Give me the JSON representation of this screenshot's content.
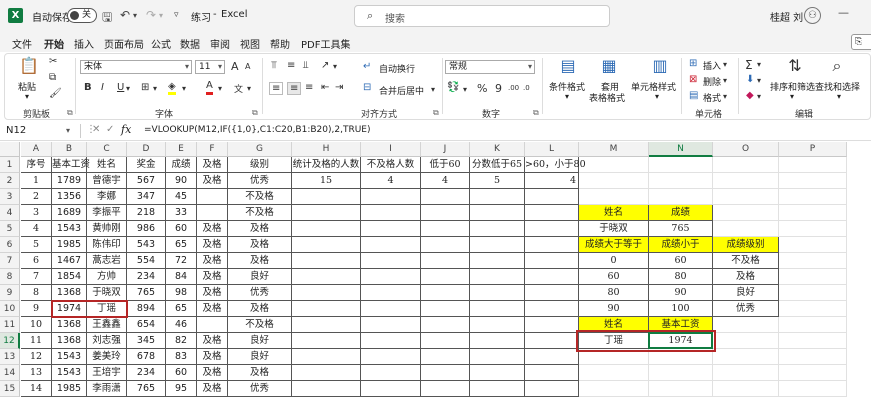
{
  "titlebar": {
    "autosave_label": "自动保存",
    "toggle_state": "关",
    "doc_name": "练习",
    "separator": "-",
    "app_name": "Excel",
    "search_placeholder": "搜索",
    "user_name": "桂超 刘"
  },
  "menu": [
    "文件",
    "开始",
    "插入",
    "页面布局",
    "公式",
    "数据",
    "审阅",
    "视图",
    "帮助",
    "PDF工具集"
  ],
  "ribbon": {
    "clipboard": {
      "label": "剪贴板",
      "paste": "粘贴"
    },
    "font": {
      "label": "字体",
      "font_name": "宋体",
      "font_size": "11",
      "bold": "B",
      "italic": "I",
      "underline": "U",
      "grow": "A",
      "shrink": "A",
      "font_color": "A"
    },
    "alignment": {
      "label": "对齐方式",
      "wrap": "自动换行",
      "merge": "合并后居中"
    },
    "number": {
      "label": "数字",
      "format": "常规",
      "percent": "%",
      "comma": "9",
      "increase": ".00",
      "decrease": ".0"
    },
    "styles": {
      "conditional": "条件格式",
      "table_l1": "套用",
      "table_l2": "表格格式",
      "cell": "单元格样式"
    },
    "cells": {
      "label": "单元格",
      "insert": "插入",
      "delete": "删除",
      "format": "格式"
    },
    "editing": {
      "label": "编辑",
      "sort": "排序和筛选",
      "find": "查找和选择"
    }
  },
  "formula_bar": {
    "name_box": "N12",
    "formula": "=VLOOKUP(M12,IF({1,0},C1:C20,B1:B20),2,TRUE)"
  },
  "colors": {
    "excel_green": "#107c41",
    "highlight_yellow": "#ffff00",
    "annotation_red": "#b52626"
  },
  "sheet": {
    "columns": [
      "A",
      "B",
      "C",
      "D",
      "E",
      "F",
      "G",
      "H",
      "I",
      "J",
      "K",
      "L",
      "M",
      "N",
      "O",
      "P"
    ],
    "rows": [
      "1",
      "2",
      "3",
      "4",
      "5",
      "6",
      "7",
      "8",
      "9",
      "10",
      "11",
      "12",
      "13",
      "14",
      "15"
    ],
    "header_row": [
      "序号",
      "基本工资",
      "姓名",
      "奖金",
      "成绩",
      "及格",
      "级别",
      "统计及格的人数",
      "不及格人数",
      "低于60",
      "分数低于65",
      ">60，小于80"
    ],
    "data": [
      [
        "1",
        "1789",
        "曾德宇",
        "567",
        "90",
        "及格",
        "优秀"
      ],
      [
        "2",
        "1356",
        "李娜",
        "347",
        "45",
        "",
        "不及格"
      ],
      [
        "3",
        "1689",
        "李振平",
        "218",
        "33",
        "",
        "不及格"
      ],
      [
        "4",
        "1543",
        "黄帅刚",
        "986",
        "60",
        "及格",
        "及格"
      ],
      [
        "5",
        "1985",
        "陈伟印",
        "543",
        "65",
        "及格",
        "及格"
      ],
      [
        "6",
        "1467",
        "蒿志岩",
        "554",
        "72",
        "及格",
        "及格"
      ],
      [
        "7",
        "1854",
        "方帅",
        "234",
        "84",
        "及格",
        "良好"
      ],
      [
        "8",
        "1368",
        "于晓双",
        "765",
        "98",
        "及格",
        "优秀"
      ],
      [
        "9",
        "1974",
        "丁瑶",
        "894",
        "65",
        "及格",
        "及格"
      ],
      [
        "10",
        "1368",
        "王鑫鑫",
        "654",
        "46",
        "",
        "不及格"
      ],
      [
        "11",
        "1368",
        "刘志强",
        "345",
        "82",
        "及格",
        "良好"
      ],
      [
        "12",
        "1543",
        "姜美玲",
        "678",
        "83",
        "及格",
        "良好"
      ],
      [
        "13",
        "1543",
        "王培宇",
        "234",
        "60",
        "及格",
        "及格"
      ],
      [
        "14",
        "1985",
        "李雨潇",
        "765",
        "95",
        "及格",
        "优秀"
      ]
    ],
    "stats": [
      "15",
      "4",
      "4",
      "5",
      "4"
    ],
    "lookup1": {
      "h1": "姓名",
      "h2": "成绩",
      "name": "于晓双",
      "score": "765"
    },
    "grade_table": {
      "headers": [
        "成绩大于等于",
        "成绩小于",
        "成绩级别"
      ],
      "rows": [
        [
          "0",
          "60",
          "不及格"
        ],
        [
          "60",
          "80",
          "及格"
        ],
        [
          "80",
          "90",
          "良好"
        ],
        [
          "90",
          "100",
          "优秀"
        ]
      ]
    },
    "lookup2": {
      "h1": "姓名",
      "h2": "基本工资",
      "name": "丁瑶",
      "salary": "1974"
    }
  }
}
